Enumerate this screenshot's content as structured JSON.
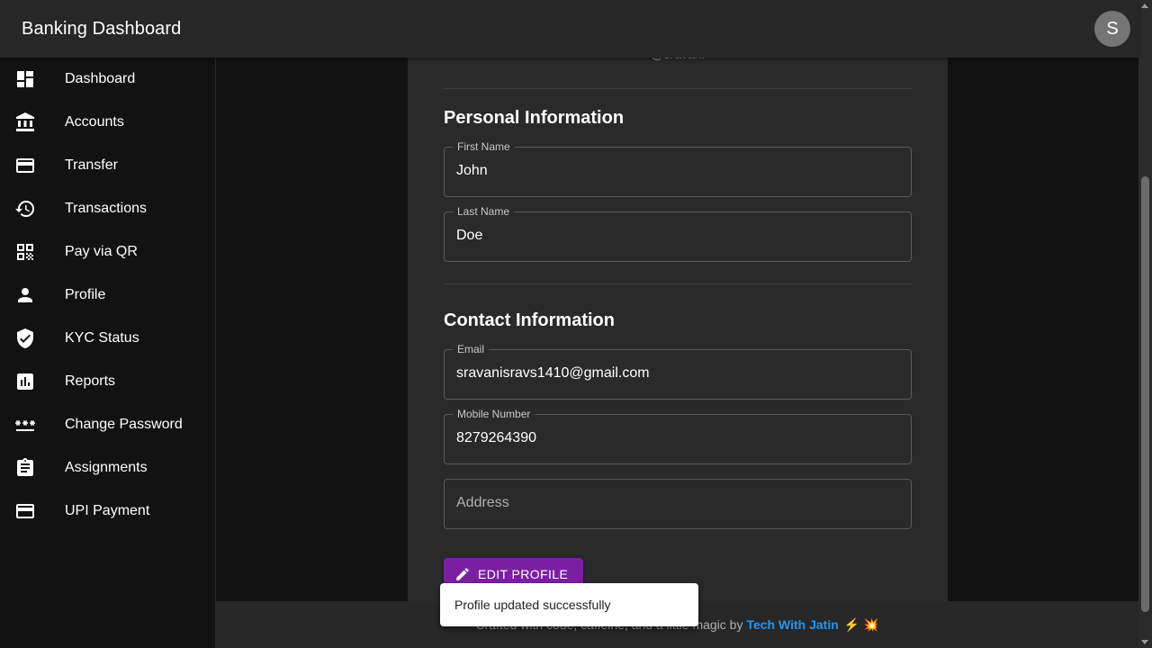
{
  "appbar": {
    "title": "Banking Dashboard",
    "avatar_initial": "S"
  },
  "sidebar": {
    "items": [
      {
        "label": "Dashboard",
        "icon": "dashboard-icon"
      },
      {
        "label": "Accounts",
        "icon": "bank-icon"
      },
      {
        "label": "Transfer",
        "icon": "credit-card-icon"
      },
      {
        "label": "Transactions",
        "icon": "history-icon"
      },
      {
        "label": "Pay via QR",
        "icon": "qr-code-icon"
      },
      {
        "label": "Profile",
        "icon": "person-icon"
      },
      {
        "label": "KYC Status",
        "icon": "verified-shield-icon"
      },
      {
        "label": "Reports",
        "icon": "bar-chart-icon"
      },
      {
        "label": "Change Password",
        "icon": "password-icon"
      },
      {
        "label": "Assignments",
        "icon": "clipboard-icon"
      },
      {
        "label": "UPI Payment",
        "icon": "credit-card-icon"
      }
    ]
  },
  "profile": {
    "username": "@sravani",
    "personal_title": "Personal Information",
    "first_name": {
      "label": "First Name",
      "value": "John"
    },
    "last_name": {
      "label": "Last Name",
      "value": "Doe"
    },
    "contact_title": "Contact Information",
    "email": {
      "label": "Email",
      "value": "sravanisravs1410@gmail.com"
    },
    "mobile": {
      "label": "Mobile Number",
      "value": "8279264390"
    },
    "address": {
      "placeholder": "Address"
    },
    "edit_button": "EDIT PROFILE"
  },
  "footer": {
    "text": "Crafted with code, caffeine, and a little magic by",
    "link": "Tech With Jatin",
    "emojis": "⚡ 💥"
  },
  "toast": {
    "message": "Profile updated successfully"
  },
  "colors": {
    "accent": "#7b1fa2",
    "link": "#2196f3",
    "appbar": "#272727",
    "card": "#2a2a2a"
  }
}
